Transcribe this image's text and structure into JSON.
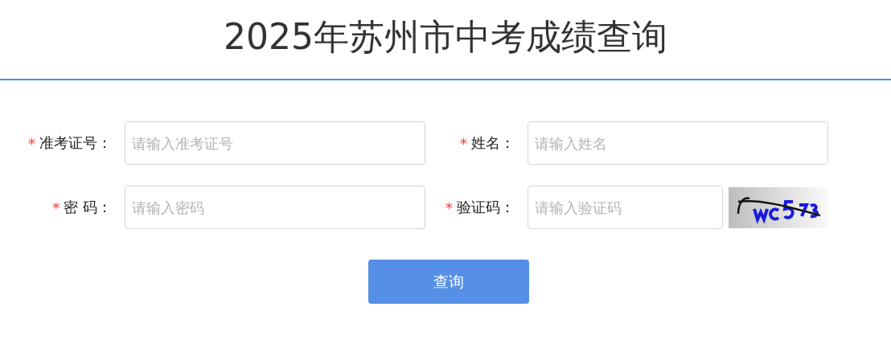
{
  "title": "2025年苏州市中考成绩查询",
  "fields": [
    {
      "marker": "*",
      "label": "准考证号：",
      "placeholder": "请输入准考证号",
      "kind": "text"
    },
    {
      "marker": "*",
      "label": "姓名：",
      "placeholder": "请输入姓名",
      "kind": "text"
    },
    {
      "marker": "*",
      "label": "密 码：",
      "placeholder": "请输入密码",
      "kind": "text"
    },
    {
      "marker": "*",
      "label": "验证码：",
      "placeholder": "请输入验证码",
      "kind": "captcha"
    }
  ],
  "submit": "查询"
}
